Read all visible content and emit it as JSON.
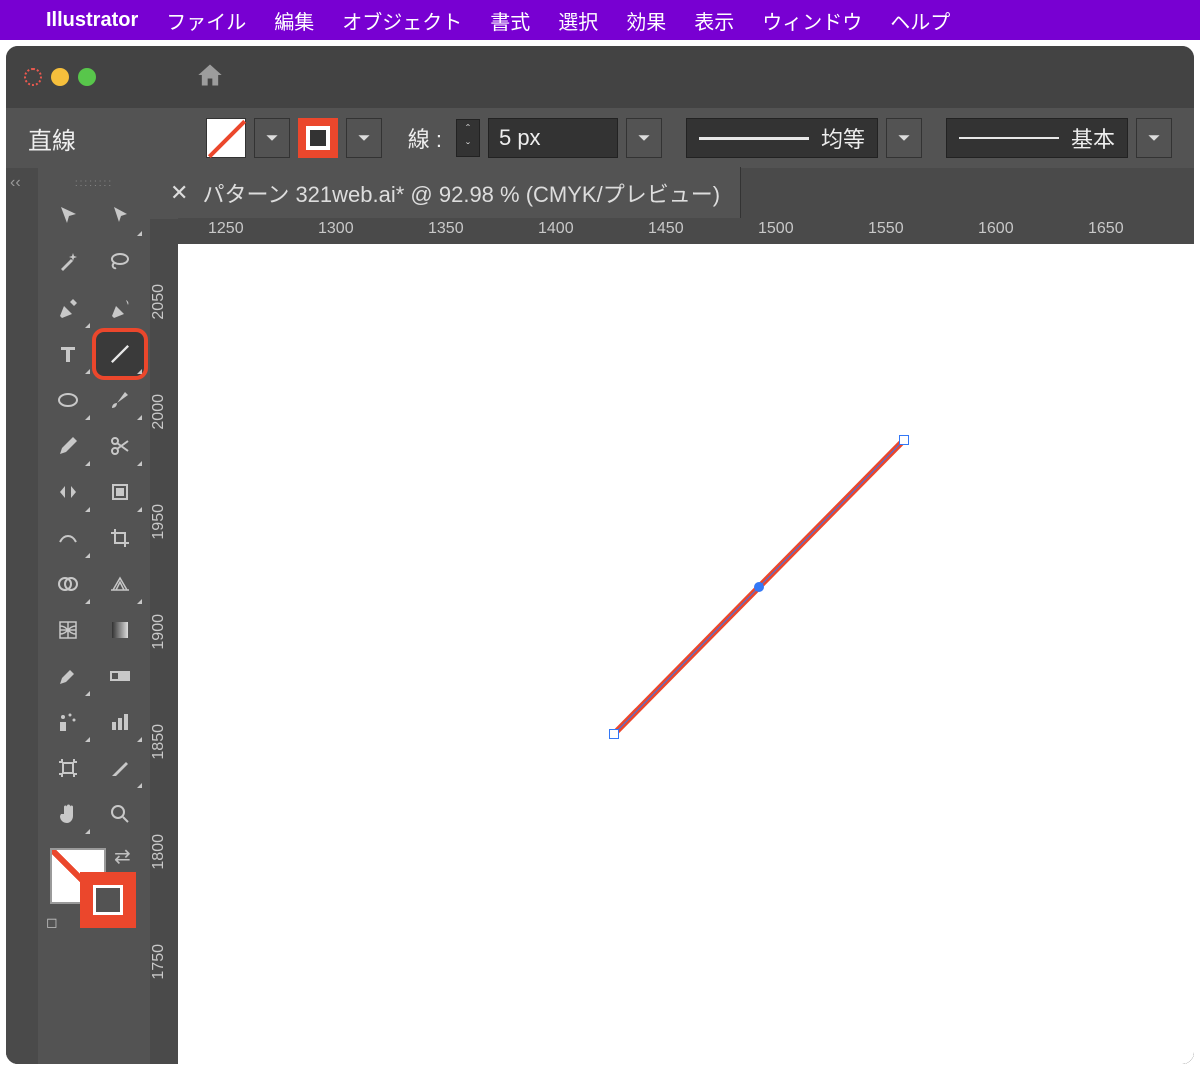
{
  "menubar": {
    "app": "Illustrator",
    "items": [
      "ファイル",
      "編集",
      "オブジェクト",
      "書式",
      "選択",
      "効果",
      "表示",
      "ウィンドウ",
      "ヘルプ"
    ]
  },
  "optionbar": {
    "tool_label": "直線",
    "stroke_label": "線 :",
    "stroke_value": "5 px",
    "profile1": "均等",
    "profile2": "基本"
  },
  "tab": {
    "title": "パターン 321web.ai* @ 92.98 % (CMYK/プレビュー)"
  },
  "ruler_h": [
    "1250",
    "1300",
    "1350",
    "1400",
    "1450",
    "1500",
    "1550",
    "1600",
    "1650"
  ],
  "ruler_v": [
    "2050",
    "2000",
    "1950",
    "1900",
    "1850",
    "1800",
    "1750"
  ],
  "collapse_glyph": "‹‹",
  "colors": {
    "accent": "#EB472C",
    "selection": "#3478F6"
  }
}
